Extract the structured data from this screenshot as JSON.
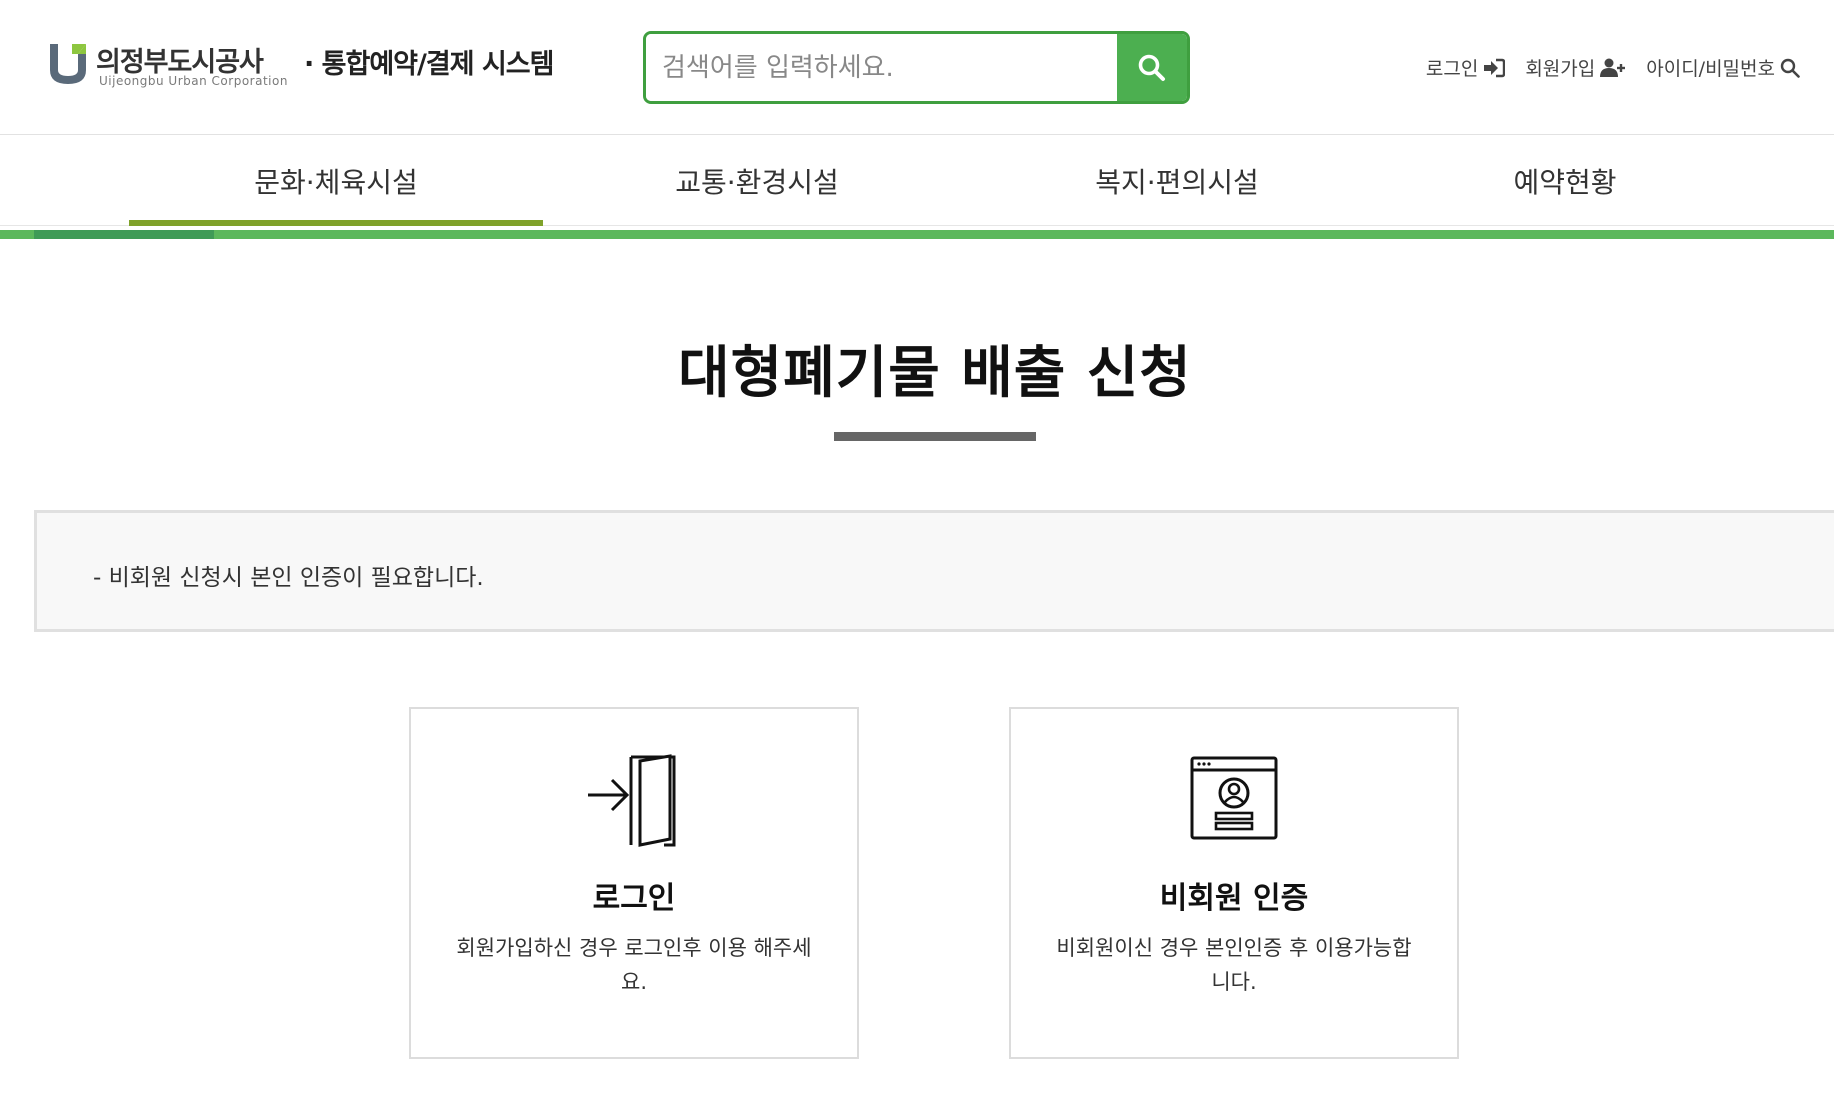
{
  "header": {
    "logo_name": "의정부도시공사",
    "logo_sub": "Uijeongbu Urban Corporation",
    "system_name": "· 통합예약/결제 시스템",
    "search": {
      "placeholder": "검색어를 입력하세요."
    },
    "util": [
      {
        "label": "로그인",
        "icon": "sign-in-icon"
      },
      {
        "label": "회원가입",
        "icon": "user-plus-icon"
      },
      {
        "label": "아이디/비밀번호",
        "icon": "search-icon"
      }
    ]
  },
  "nav": {
    "items": [
      {
        "label": "문화·체육시설",
        "active": true
      },
      {
        "label": "교통·환경시설",
        "active": false
      },
      {
        "label": "복지·편의시설",
        "active": false
      },
      {
        "label": "예약현황",
        "active": false
      }
    ]
  },
  "page": {
    "title": "대형폐기물 배출 신청",
    "notice": "- 비회원 신청시 본인 인증이 필요합니다."
  },
  "cards": [
    {
      "title": "로그인",
      "description": "회원가입하신 경우 로그인후 이용 해주세요.",
      "icon": "door-enter-icon"
    },
    {
      "title": "비회원 인증",
      "description": "비회원이신 경우 본인인증 후 이용가능합니다.",
      "icon": "id-card-icon"
    }
  ],
  "colors": {
    "brand_green": "#4caf50",
    "nav_active": "#7fa22a",
    "bar_green": "#5cb85c"
  }
}
